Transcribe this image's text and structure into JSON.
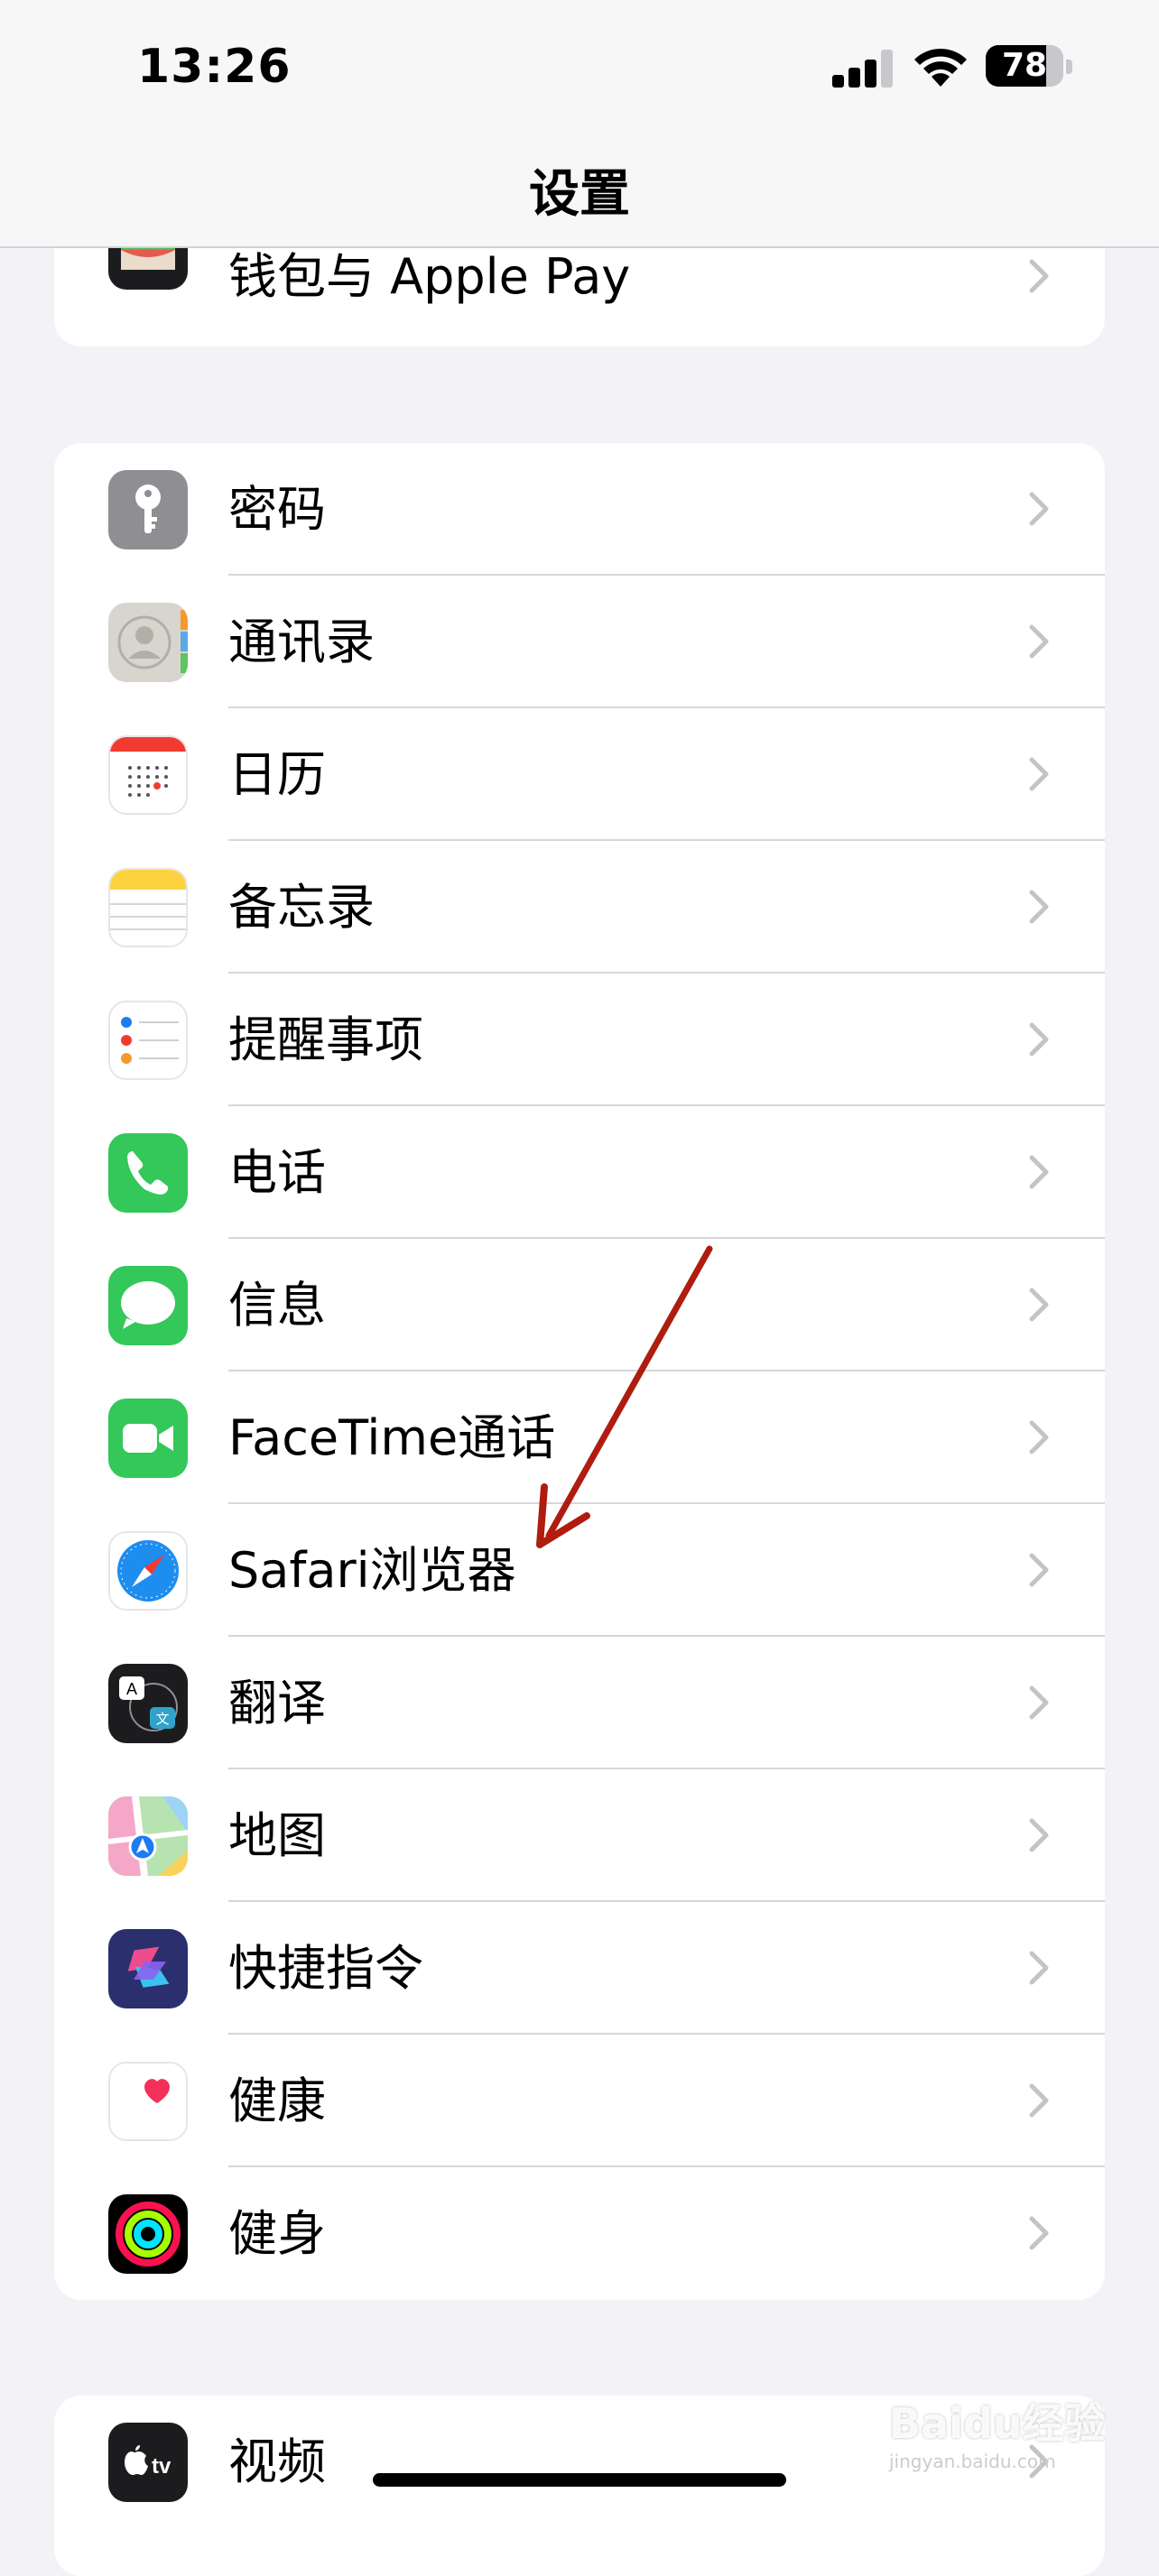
{
  "status_bar": {
    "time": "13:26",
    "battery": "78",
    "battery_level": 0.78
  },
  "nav": {
    "title": "设置"
  },
  "groups": [
    {
      "items": [
        {
          "label": "钱包与 Apple Pay",
          "icon": "wallet-icon"
        }
      ]
    },
    {
      "items": [
        {
          "label": "密码",
          "icon": "key-icon"
        },
        {
          "label": "通讯录",
          "icon": "contacts-icon"
        },
        {
          "label": "日历",
          "icon": "calendar-icon"
        },
        {
          "label": "备忘录",
          "icon": "notes-icon"
        },
        {
          "label": "提醒事项",
          "icon": "reminders-icon"
        },
        {
          "label": "电话",
          "icon": "phone-icon"
        },
        {
          "label": "信息",
          "icon": "messages-icon"
        },
        {
          "label": "FaceTime通话",
          "icon": "facetime-icon"
        },
        {
          "label": "Safari浏览器",
          "icon": "safari-icon"
        },
        {
          "label": "翻译",
          "icon": "translate-icon"
        },
        {
          "label": "地图",
          "icon": "maps-icon"
        },
        {
          "label": "快捷指令",
          "icon": "shortcuts-icon"
        },
        {
          "label": "健康",
          "icon": "health-icon"
        },
        {
          "label": "健身",
          "icon": "fitness-icon"
        }
      ]
    },
    {
      "items": [
        {
          "label": "视频",
          "icon": "apple-tv-icon"
        }
      ]
    }
  ],
  "colors": {
    "annotation_arrow": "#b01c10",
    "background": "#f2f2f7"
  },
  "watermark": {
    "brand": "Baidu经验",
    "url": "jingyan.baidu.com"
  }
}
